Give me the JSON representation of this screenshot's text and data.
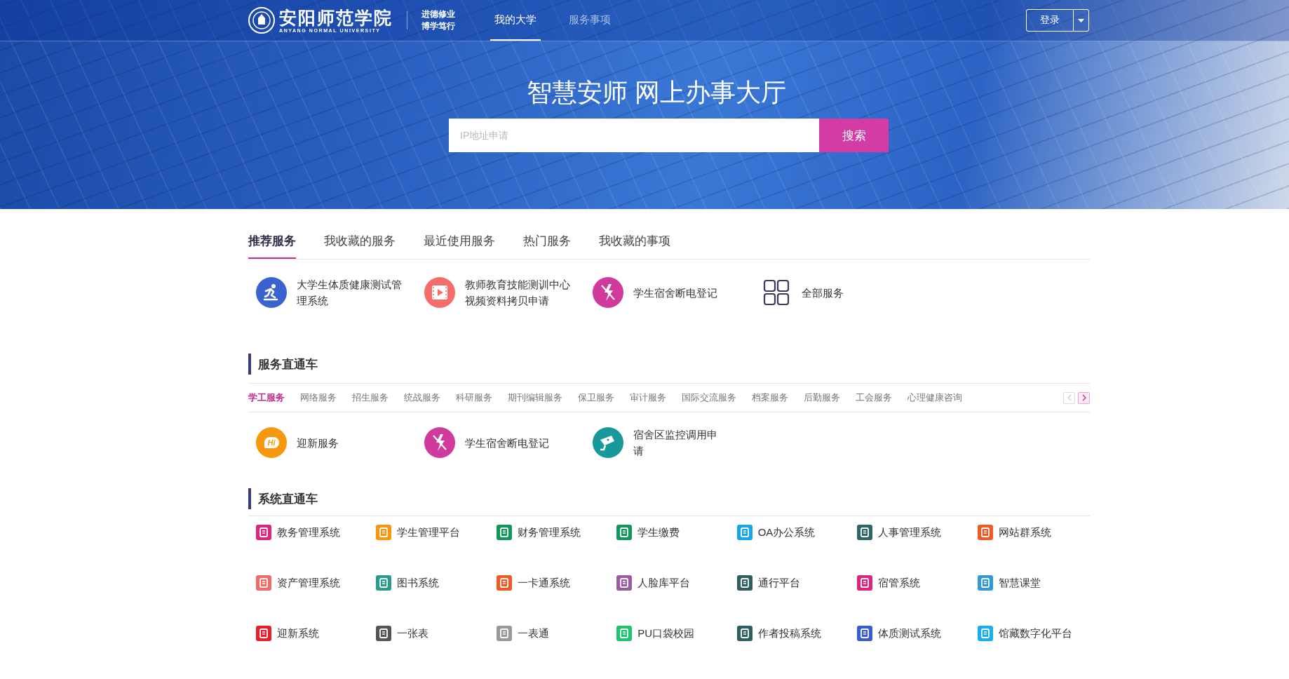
{
  "header": {
    "logo_name": "安阳师范学院",
    "logo_subtitle": "ANYANG NORMAL UNIVERSITY",
    "motto": [
      "进德修业",
      "博学笃行"
    ],
    "nav": [
      {
        "label": "我的大学",
        "selected": true
      },
      {
        "label": "服务事项",
        "selected": false
      }
    ],
    "login_button": "登录"
  },
  "banner": {
    "title": "智慧安师 网上办事大厅",
    "search": {
      "placeholder": "IP地址申请",
      "button": "搜索"
    }
  },
  "recommended": {
    "tabs": [
      {
        "label": "推荐服务",
        "selected": true
      },
      {
        "label": "我收藏的服务",
        "selected": false
      },
      {
        "label": "最近使用服务",
        "selected": false
      },
      {
        "label": "热门服务",
        "selected": false
      },
      {
        "label": "我收藏的事项",
        "selected": false
      }
    ],
    "items": [
      {
        "kind": "app",
        "label": "大学生体质健康测试管理系统",
        "color": "#3a63cf"
      },
      {
        "kind": "app",
        "label": "教师教育技能测训中心视频资料拷贝申请",
        "color": "#f56d6a"
      },
      {
        "kind": "app",
        "label": "学生宿舍断电登记",
        "color": "#cf3a9c"
      },
      {
        "kind": "all",
        "label": "全部服务"
      }
    ]
  },
  "service_express": {
    "title": "服务直通车",
    "categories": [
      {
        "label": "学工服务",
        "selected": true
      },
      {
        "label": "网络服务",
        "selected": false
      },
      {
        "label": "招生服务",
        "selected": false
      },
      {
        "label": "统战服务",
        "selected": false
      },
      {
        "label": "科研服务",
        "selected": false
      },
      {
        "label": "期刊编辑服务",
        "selected": false
      },
      {
        "label": "保卫服务",
        "selected": false
      },
      {
        "label": "审计服务",
        "selected": false
      },
      {
        "label": "国际交流服务",
        "selected": false
      },
      {
        "label": "档案服务",
        "selected": false
      },
      {
        "label": "后勤服务",
        "selected": false
      },
      {
        "label": "工会服务",
        "selected": false
      },
      {
        "label": "心理健康咨询",
        "selected": false
      }
    ],
    "scroll_buttons": [
      {
        "disabled": true
      },
      {
        "disabled": false
      }
    ],
    "items": [
      {
        "label": "迎新服务",
        "color": "#f7980e",
        "icon_text": "Hi"
      },
      {
        "label": "学生宿舍断电登记",
        "color": "#cf3a9c"
      },
      {
        "label": "宿舍区监控调用申请",
        "color": "#17989a"
      }
    ]
  },
  "system_express": {
    "title": "系统直通车",
    "items": [
      {
        "label": "教务管理系统",
        "color": "#d9267c"
      },
      {
        "label": "学生管理平台",
        "color": "#fa960e"
      },
      {
        "label": "财务管理系统",
        "color": "#11975b"
      },
      {
        "label": "学生缴费",
        "color": "#11975b"
      },
      {
        "label": "OA办公系统",
        "color": "#17a6e8"
      },
      {
        "label": "人事管理系统",
        "color": "#2f6566"
      },
      {
        "label": "网站群系统",
        "color": "#f25a25"
      },
      {
        "label": "资产管理系统",
        "color": "#f26b6b"
      },
      {
        "label": "图书系统",
        "color": "#2a9c8e"
      },
      {
        "label": "一卡通系统",
        "color": "#f25a25"
      },
      {
        "label": "人脸库平台",
        "color": "#9a5c9e"
      },
      {
        "label": "通行平台",
        "color": "#2f5f5e"
      },
      {
        "label": "宿管系统",
        "color": "#d9267c"
      },
      {
        "label": "智慧课堂",
        "color": "#3499d8"
      },
      {
        "label": "迎新系统",
        "color": "#e81f2b"
      },
      {
        "label": "一张表",
        "color": "#555555"
      },
      {
        "label": "一表通",
        "color": "#999999"
      },
      {
        "label": "PU口袋校园",
        "color": "#1ec46f"
      },
      {
        "label": "作者投稿系统",
        "color": "#2f5f5e"
      },
      {
        "label": "体质测试系统",
        "color": "#3a5cd0"
      },
      {
        "label": "馆藏数字化平台",
        "color": "#19aef0"
      }
    ]
  }
}
